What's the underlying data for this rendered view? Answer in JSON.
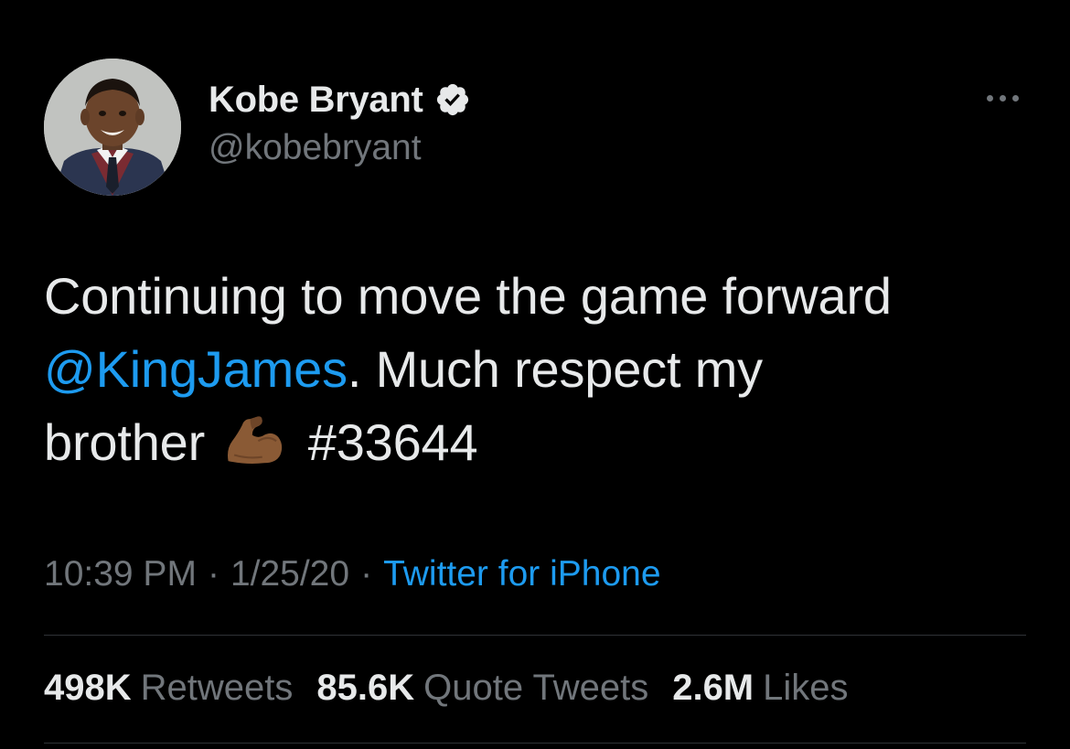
{
  "author": {
    "display_name": "Kobe Bryant",
    "handle": "@kobebryant",
    "verified": true,
    "verified_icon": "verified-badge-icon",
    "avatar": "profile-photo"
  },
  "more_icon": "more-dots-icon",
  "tweet": {
    "line1": "Continuing to move the game forward",
    "mention": "@KingJames",
    "line2_rest": ". Much respect my",
    "line3_start": "brother",
    "emoji": "flexed-biceps-emoji",
    "hashtag": "#33644"
  },
  "meta": {
    "time": "10:39 PM",
    "separator": "·",
    "date": "1/25/20",
    "source": "Twitter for iPhone"
  },
  "stats": {
    "retweets_count": "498K",
    "retweets_label": "Retweets",
    "quotes_count": "85.6K",
    "quotes_label": "Quote Tweets",
    "likes_count": "2.6M",
    "likes_label": "Likes"
  },
  "colors": {
    "background": "#000000",
    "text": "#e7e9ea",
    "secondary": "#71767b",
    "link": "#1d9bf0",
    "divider": "#2f3336"
  }
}
